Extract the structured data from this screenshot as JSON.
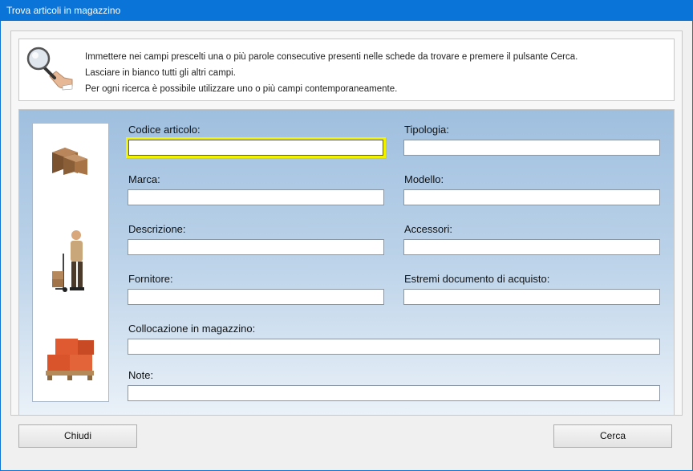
{
  "window": {
    "title": "Trova articoli in magazzino"
  },
  "info": {
    "lines": [
      "Immettere nei campi prescelti una o più parole consecutive presenti nelle schede da trovare e premere il pulsante Cerca.",
      "Lasciare in bianco tutti gli altri campi.",
      "Per ogni ricerca è possibile utilizzare uno o più campi contemporaneamente."
    ]
  },
  "fields": {
    "codice": {
      "label": "Codice articolo:",
      "value": ""
    },
    "tipologia": {
      "label": "Tipologia:",
      "value": ""
    },
    "marca": {
      "label": "Marca:",
      "value": ""
    },
    "modello": {
      "label": "Modello:",
      "value": ""
    },
    "descrizione": {
      "label": "Descrizione:",
      "value": ""
    },
    "accessori": {
      "label": "Accessori:",
      "value": ""
    },
    "fornitore": {
      "label": "Fornitore:",
      "value": ""
    },
    "estremi": {
      "label": "Estremi documento di acquisto:",
      "value": ""
    },
    "collocazione": {
      "label": "Collocazione in magazzino:",
      "value": ""
    },
    "note": {
      "label": "Note:",
      "value": ""
    }
  },
  "buttons": {
    "close": "Chiudi",
    "search": "Cerca"
  },
  "icons": [
    "magnifier-hand-icon",
    "boxes-icon",
    "delivery-man-icon",
    "pallet-icon"
  ],
  "colors": {
    "titlebar": "#0a74d8",
    "focus": "#f2f200",
    "panel_top": "#9fbfdf",
    "panel_bottom": "#eaf1f8"
  }
}
